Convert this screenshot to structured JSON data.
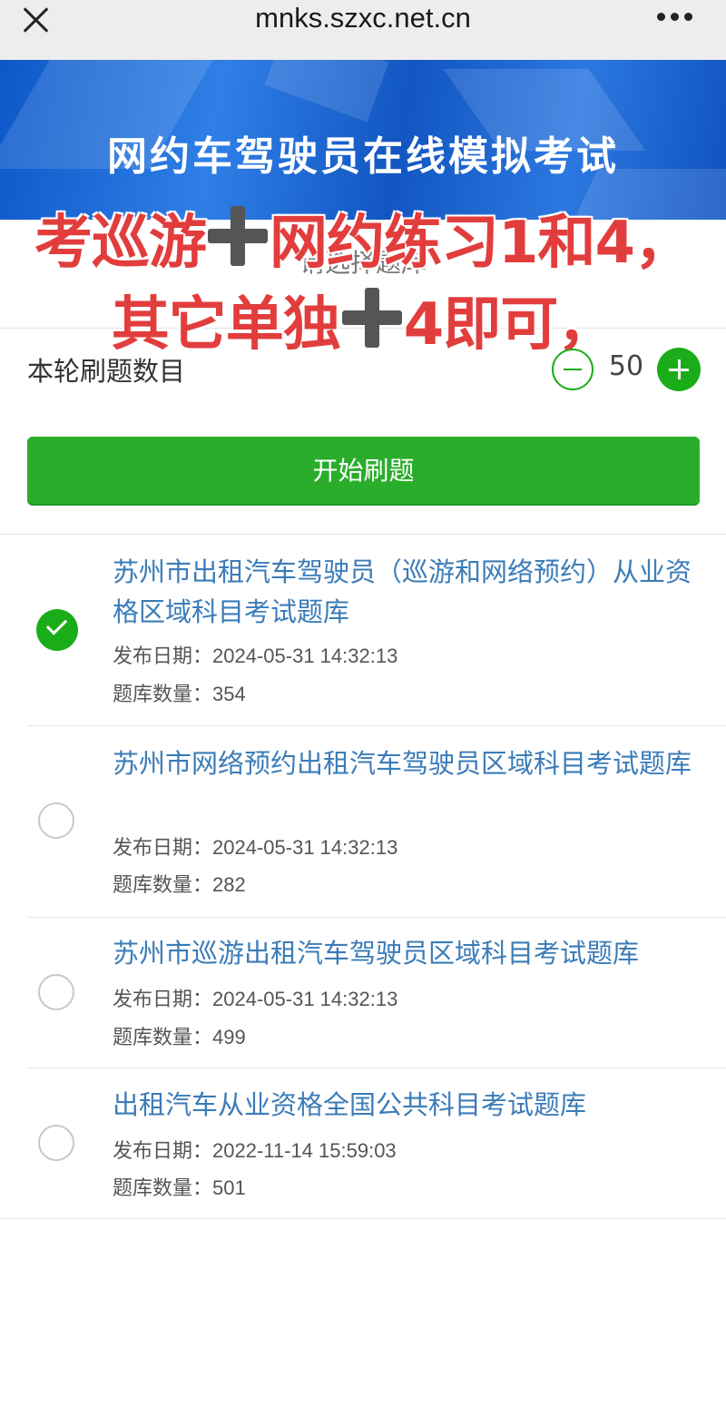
{
  "browser": {
    "url": "mnks.szxc.net.cn"
  },
  "banner": {
    "title": "网约车驾驶员在线模拟考试"
  },
  "prompt": "请选择题库",
  "overlay": {
    "line1_a": "考巡游",
    "line1_b": "网约练习1和4，",
    "line2_a": "其它单独",
    "line2_b": "4即可，",
    "color": "#e23d3d"
  },
  "counter": {
    "label": "本轮刷题数目",
    "value": "50"
  },
  "start_button": {
    "label": "开始刷题",
    "color": "#2aad2b"
  },
  "banks": [
    {
      "title": "苏州市出租汽车驾驶员（巡游和网络预约）从业资格区域科目考试题库",
      "date_label": "发布日期：",
      "date": "2024-05-31 14:32:13",
      "count_label": "题库数量：",
      "count": "354",
      "selected": true
    },
    {
      "title": "苏州市网络预约出租汽车驾驶员区域科目考试题库",
      "date_label": "发布日期：",
      "date": "2024-05-31 14:32:13",
      "count_label": "题库数量：",
      "count": "282",
      "selected": false
    },
    {
      "title": "苏州市巡游出租汽车驾驶员区域科目考试题库",
      "date_label": "发布日期：",
      "date": "2024-05-31 14:32:13",
      "count_label": "题库数量：",
      "count": "499",
      "selected": false
    },
    {
      "title": "出租汽车从业资格全国公共科目考试题库",
      "date_label": "发布日期：",
      "date": "2022-11-14 15:59:03",
      "count_label": "题库数量：",
      "count": "501",
      "selected": false
    }
  ],
  "icons": [
    "close-icon",
    "more-icon",
    "minus-icon",
    "plus-icon",
    "check-icon"
  ]
}
